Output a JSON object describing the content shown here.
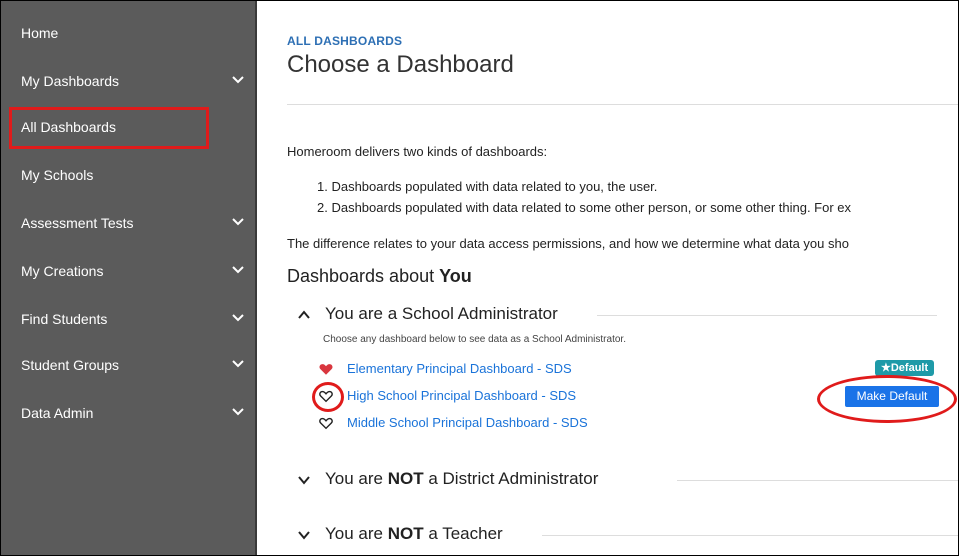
{
  "sidebar": {
    "items": [
      {
        "label": "Home",
        "has_chevron": false
      },
      {
        "label": "My Dashboards",
        "has_chevron": true
      },
      {
        "label": "All Dashboards",
        "has_chevron": false,
        "active": true
      },
      {
        "label": "My Schools",
        "has_chevron": false
      },
      {
        "label": "Assessment Tests",
        "has_chevron": true
      },
      {
        "label": "My Creations",
        "has_chevron": true
      },
      {
        "label": "Find Students",
        "has_chevron": true
      },
      {
        "label": "Student Groups",
        "has_chevron": true
      },
      {
        "label": "Data Admin",
        "has_chevron": true
      }
    ]
  },
  "main": {
    "breadcrumb": "ALL DASHBOARDS",
    "title": "Choose a Dashboard",
    "intro": "Homeroom delivers two kinds of dashboards:",
    "list": [
      "1. Dashboards populated with data related to you, the user.",
      "2. Dashboards populated with data related to some other person, or some other thing. For ex"
    ],
    "difference": "The difference relates to your data access permissions, and how we determine what data you sho",
    "heading_prefix": "Dashboards about ",
    "heading_bold": "You",
    "sections": [
      {
        "prefix": "You are a School Administrator",
        "bold": "",
        "suffix": "",
        "expanded": true
      },
      {
        "prefix": "You are ",
        "bold": "NOT",
        "suffix": " a District Administrator",
        "expanded": false
      },
      {
        "prefix": "You are ",
        "bold": "NOT",
        "suffix": " a Teacher",
        "expanded": false
      }
    ],
    "section_subtitle": "Choose any dashboard below to see data as a School Administrator.",
    "dashboards": [
      {
        "name": "Elementary Principal Dashboard - SDS",
        "favorited": true
      },
      {
        "name": "High School Principal Dashboard - SDS",
        "favorited": false
      },
      {
        "name": "Middle School Principal Dashboard - SDS",
        "favorited": false
      }
    ],
    "default_badge": "★Default",
    "make_default_label": "Make Default"
  },
  "colors": {
    "sidebar_bg": "#5b5b5b",
    "link": "#1a73d9",
    "breadcrumb": "#2d6fb4",
    "annotation": "#e01b1b",
    "button": "#1a73e8",
    "badge": "#1e9aa8",
    "heart_filled": "#d9363e"
  }
}
